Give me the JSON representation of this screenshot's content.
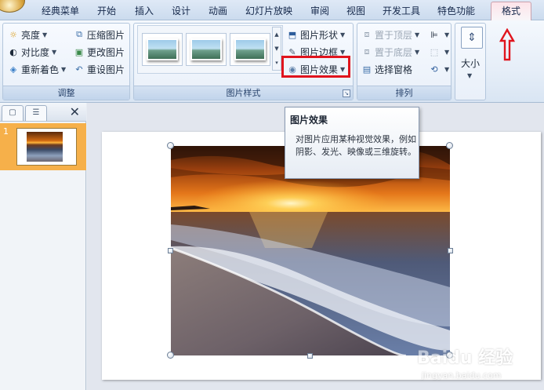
{
  "tabs": {
    "items": [
      "经典菜单",
      "开始",
      "插入",
      "设计",
      "动画",
      "幻灯片放映",
      "审阅",
      "视图",
      "开发工具",
      "特色功能"
    ],
    "active": "格式"
  },
  "ribbon": {
    "adjust": {
      "label": "调整",
      "brightness": "亮度",
      "contrast": "对比度",
      "recolor": "重新着色",
      "compress": "压缩图片",
      "change": "更改图片",
      "reset": "重设图片"
    },
    "picture_styles": {
      "label": "图片样式",
      "shape": "图片形状",
      "border": "图片边框",
      "effects": "图片效果"
    },
    "arrange": {
      "label": "排列",
      "bring_front": "置于顶层",
      "send_back": "置于底层",
      "selection_pane": "选择窗格"
    },
    "size": {
      "label": "大小"
    }
  },
  "slide_panel": {
    "slide_number": "1"
  },
  "tooltip": {
    "title": "图片效果",
    "body": "对图片应用某种视觉效果，例如阴影、发光、映像或三维旋转。"
  },
  "watermark": {
    "brand": "Baidu 经验",
    "url": "jingyan.baidu.com"
  },
  "colors": {
    "highlight": "#e0141d",
    "selected_slide": "#f6b04a"
  }
}
